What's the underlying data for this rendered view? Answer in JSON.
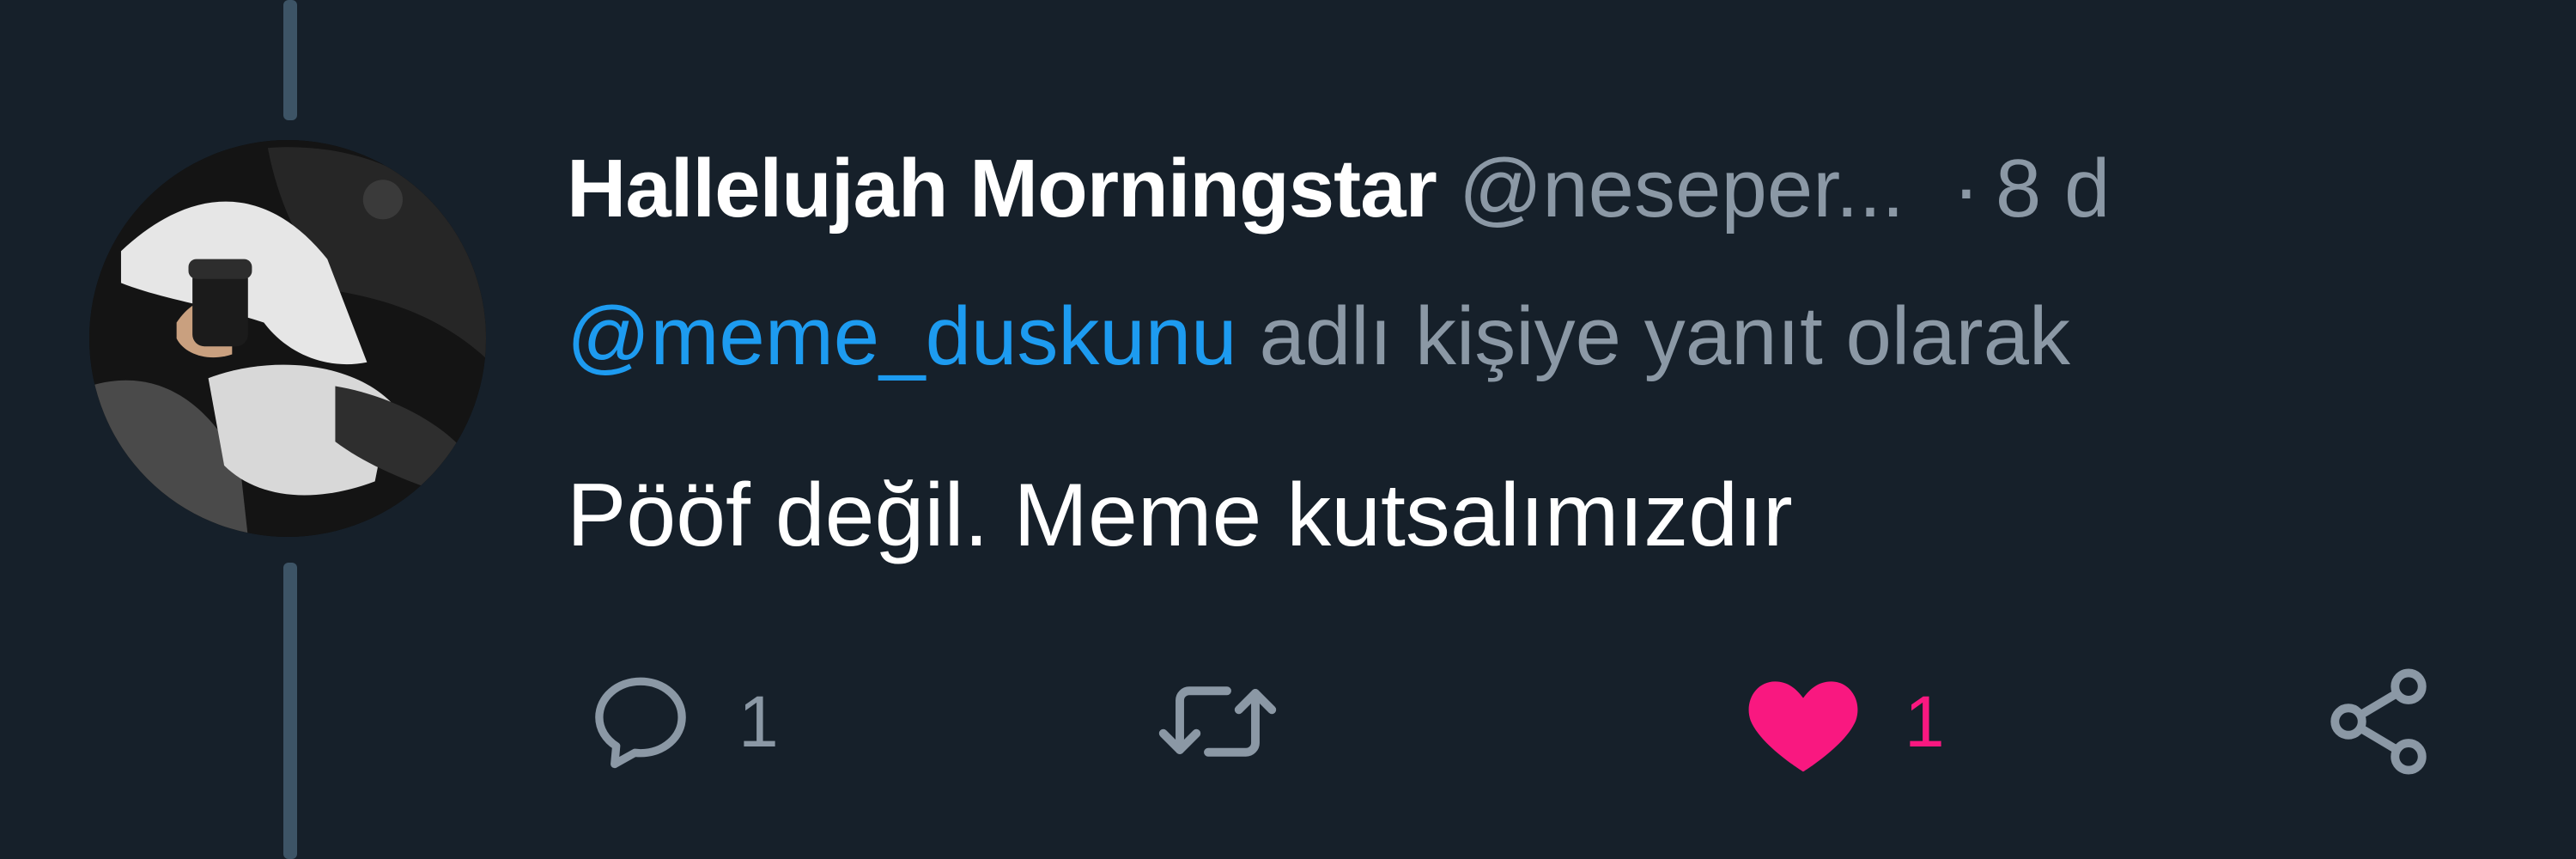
{
  "tweet": {
    "author_name": "Hallelujah Morningstar",
    "author_handle": "@neseper...",
    "separator": "·",
    "time": "8 d",
    "reply_to_handle": "@meme_duskunu",
    "reply_to_suffix": "adlı kişiye yanıt olarak",
    "text": "Pööf değil. Meme kutsalımızdır"
  },
  "actions": {
    "reply": {
      "icon": "reply-icon",
      "count": "1"
    },
    "retweet": {
      "icon": "retweet-icon",
      "count": ""
    },
    "like": {
      "icon": "heart-icon",
      "count": "1",
      "liked": true
    },
    "share": {
      "icon": "share-icon"
    }
  },
  "colors": {
    "background": "#16202a",
    "thread_line": "#3d5466",
    "muted_text": "#8b98a5",
    "mention": "#1d9bf0",
    "like": "#f91880"
  }
}
